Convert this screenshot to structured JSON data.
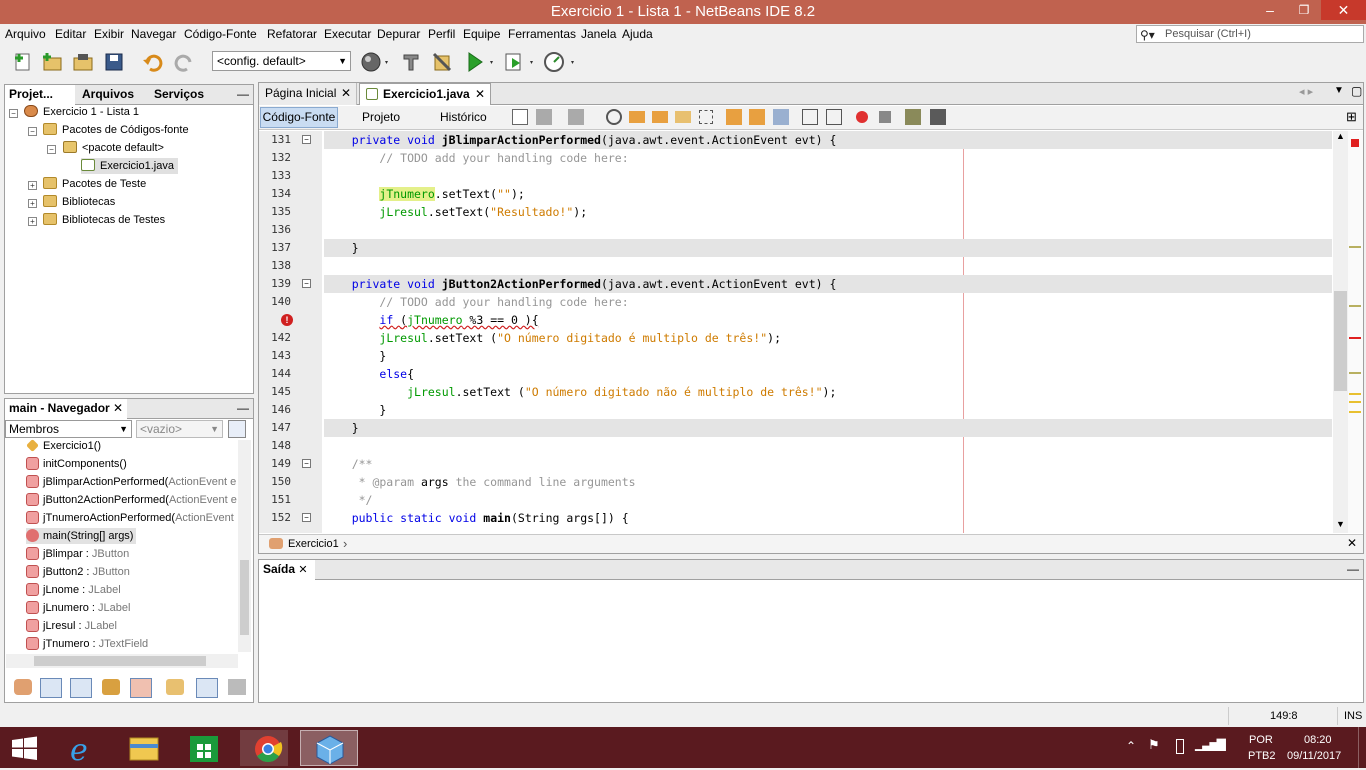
{
  "window": {
    "title": "Exercicio 1 - Lista 1 - NetBeans IDE 8.2",
    "minimize": "‒",
    "maximize": "❐",
    "close": "✕"
  },
  "menu": [
    "Arquivo",
    "Editar",
    "Exibir",
    "Navegar",
    "Código-Fonte",
    "Refatorar",
    "Executar",
    "Depurar",
    "Perfil",
    "Equipe",
    "Ferramentas",
    "Janela",
    "Ajuda"
  ],
  "search": {
    "placeholder": "Pesquisar (Ctrl+I)"
  },
  "toolbar": {
    "config": "<config. default>"
  },
  "projects_panel": {
    "tabs": [
      "Projet...",
      "Arquivos",
      "Serviços"
    ],
    "minimize": "—",
    "tree": [
      "Exercicio 1 - Lista 1",
      "Pacotes de Códigos-fonte",
      "<pacote default>",
      "Exercicio1.java",
      "Pacotes de Teste",
      "Bibliotecas",
      "Bibliotecas de Testes"
    ]
  },
  "navigator": {
    "title": "main - Navegador",
    "close": "✕",
    "filter": "Membros",
    "filter2": "<vazio>",
    "items": [
      {
        "name": "Exercicio1()",
        "type": ""
      },
      {
        "name": "initComponents()",
        "type": ""
      },
      {
        "name": "jBlimparActionPerformed(",
        "type": "ActionEvent e"
      },
      {
        "name": "jButton2ActionPerformed(",
        "type": "ActionEvent e"
      },
      {
        "name": "jTnumeroActionPerformed(",
        "type": "ActionEvent"
      },
      {
        "name": "main(String[] args)",
        "type": ""
      },
      {
        "name": "jBlimpar : ",
        "type": "JButton"
      },
      {
        "name": "jButton2 : ",
        "type": "JButton"
      },
      {
        "name": "jLnome : ",
        "type": "JLabel"
      },
      {
        "name": "jLnumero : ",
        "type": "JLabel"
      },
      {
        "name": "jLresul : ",
        "type": "JLabel"
      },
      {
        "name": "jTnumero : ",
        "type": "JTextField"
      }
    ]
  },
  "editor": {
    "tabs": [
      "Página Inicial",
      "Exercicio1.java"
    ],
    "subtabs": [
      "Código-Fonte",
      "Projeto",
      "Histórico"
    ],
    "breadcrumb": "Exercicio1",
    "lines": [
      {
        "n": "131",
        "parts": [
          [
            "    ",
            ""
          ],
          [
            "private void ",
            "kw"
          ],
          [
            "jBlimparActionPerformed",
            "mth"
          ],
          [
            "(java.awt.event.ActionEvent ",
            ""
          ],
          [
            "evt",
            ""
          ],
          [
            ") {",
            ""
          ]
        ],
        "hl": true,
        "fold": "−"
      },
      {
        "n": "132",
        "parts": [
          [
            "        // TODO add your handling code here:",
            "cm"
          ]
        ]
      },
      {
        "n": "133",
        "parts": []
      },
      {
        "n": "134",
        "parts": [
          [
            "        ",
            ""
          ],
          [
            "jTnumero",
            "fld"
          ],
          [
            ".setText(",
            ""
          ],
          [
            "\"\"",
            "str"
          ],
          [
            ");",
            ""
          ]
        ]
      },
      {
        "n": "135",
        "parts": [
          [
            "        ",
            ""
          ],
          [
            "jLresul",
            "fld"
          ],
          [
            ".setText(",
            ""
          ],
          [
            "\"Resultado!\"",
            "str"
          ],
          [
            ");",
            ""
          ]
        ]
      },
      {
        "n": "136",
        "parts": []
      },
      {
        "n": "137",
        "parts": [
          [
            "    }",
            ""
          ]
        ],
        "hl": true
      },
      {
        "n": "138",
        "parts": []
      },
      {
        "n": "139",
        "parts": [
          [
            "    ",
            ""
          ],
          [
            "private void ",
            "kw"
          ],
          [
            "jButton2ActionPerformed",
            "mth"
          ],
          [
            "(java.awt.event.ActionEvent ",
            ""
          ],
          [
            "evt",
            ""
          ],
          [
            ") {",
            ""
          ]
        ],
        "hl": true,
        "fold": "−"
      },
      {
        "n": "140",
        "parts": [
          [
            "        // TODO add your handling code here:",
            "cm"
          ]
        ]
      },
      {
        "n": "",
        "parts": [
          [
            "        ",
            ""
          ],
          [
            "if",
            "kw"
          ],
          [
            " (",
            ""
          ],
          [
            "jTnumero",
            "fld"
          ],
          [
            " %3 == 0 ){",
            ""
          ]
        ],
        "err": true
      },
      {
        "n": "142",
        "parts": [
          [
            "        ",
            ""
          ],
          [
            "jLresul",
            "fld"
          ],
          [
            ".setText (",
            ""
          ],
          [
            "\"O número digitado é multiplo de três!\"",
            "str"
          ],
          [
            ");",
            ""
          ]
        ]
      },
      {
        "n": "143",
        "parts": [
          [
            "        }",
            ""
          ]
        ]
      },
      {
        "n": "144",
        "parts": [
          [
            "        ",
            ""
          ],
          [
            "else",
            "kw"
          ],
          [
            "{",
            ""
          ]
        ]
      },
      {
        "n": "145",
        "parts": [
          [
            "            ",
            ""
          ],
          [
            "jLresul",
            "fld"
          ],
          [
            ".setText (",
            ""
          ],
          [
            "\"O número digitado não é multiplo de três!\"",
            "str"
          ],
          [
            ");",
            ""
          ]
        ]
      },
      {
        "n": "146",
        "parts": [
          [
            "        }",
            ""
          ]
        ]
      },
      {
        "n": "147",
        "parts": [
          [
            "    }",
            ""
          ]
        ],
        "hl": true
      },
      {
        "n": "148",
        "parts": []
      },
      {
        "n": "149",
        "parts": [
          [
            "    /**",
            "cm"
          ]
        ],
        "fold": "−"
      },
      {
        "n": "150",
        "parts": [
          [
            "     * @param ",
            "cm"
          ],
          [
            "args",
            "nb"
          ],
          [
            " the command line arguments",
            "cm"
          ]
        ]
      },
      {
        "n": "151",
        "parts": [
          [
            "     */",
            "cm"
          ]
        ]
      },
      {
        "n": "152",
        "parts": [
          [
            "    ",
            ""
          ],
          [
            "public static void ",
            "kw"
          ],
          [
            "main",
            "mth"
          ],
          [
            "(String args[]) {",
            ""
          ]
        ],
        "fold": "−"
      }
    ]
  },
  "output": {
    "title": "Saída",
    "close": "✕"
  },
  "status": {
    "position": "149:8",
    "mode": "INS"
  },
  "taskbar": {
    "lang1": "POR",
    "lang2": "PTB2",
    "time": "08:20",
    "date": "09/11/2017"
  }
}
